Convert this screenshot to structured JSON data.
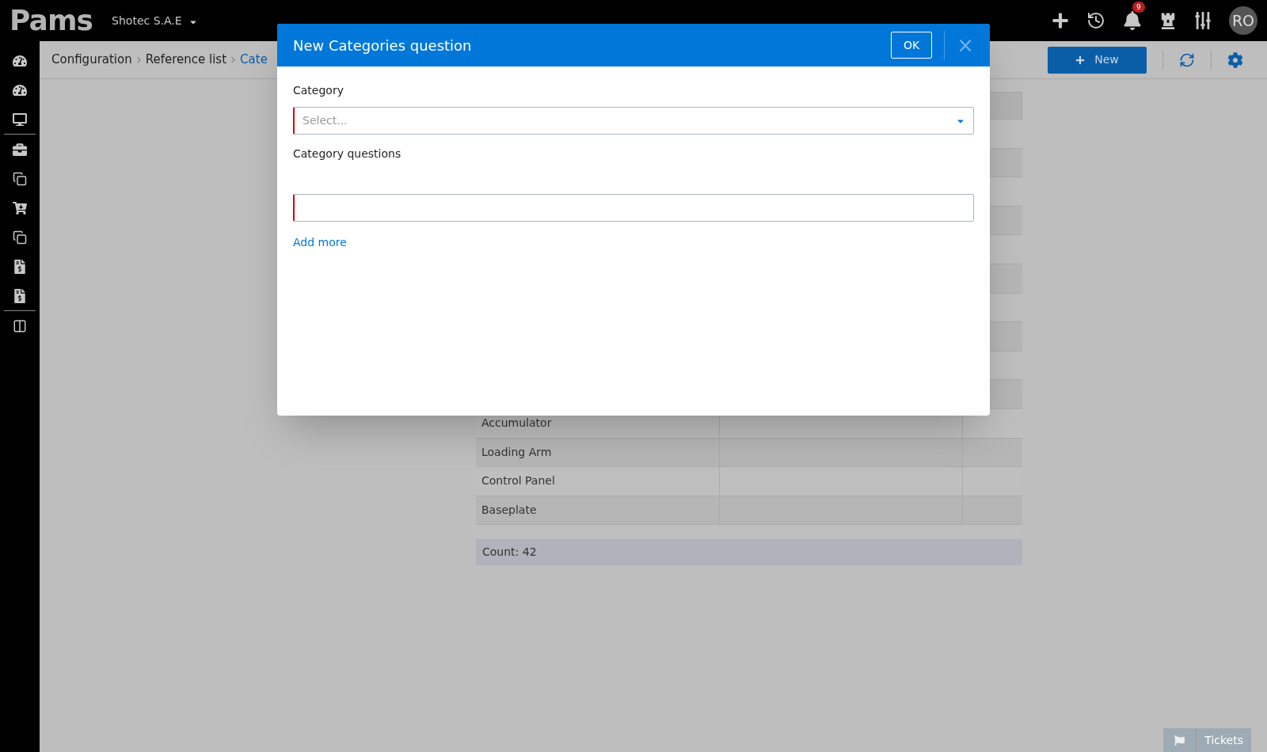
{
  "top_bar": {
    "logo": "Pams",
    "company": "Shotec S.A.E",
    "notification_count": "9",
    "avatar": "RO"
  },
  "breadcrumb": [
    "Configuration",
    "Reference list",
    "Cate"
  ],
  "toolbar": {
    "new_button": "New"
  },
  "table": {
    "rows": [
      {
        "column_1": "Accumulator"
      },
      {
        "column_1": "Loading Arm"
      },
      {
        "column_1": "Control Panel"
      },
      {
        "column_1": "Baseplate"
      }
    ],
    "count": "Count: 42"
  },
  "dialog": {
    "title": "New Categories question",
    "ok": "OK",
    "close": "×",
    "category": {
      "label": "Category",
      "placeholder": "Select...",
      "required": true
    },
    "questions": {
      "label": "Category questions",
      "fields": [
        {
          "required": true
        }
      ],
      "add_more": "Add more"
    }
  },
  "tickets": "Tickets"
}
